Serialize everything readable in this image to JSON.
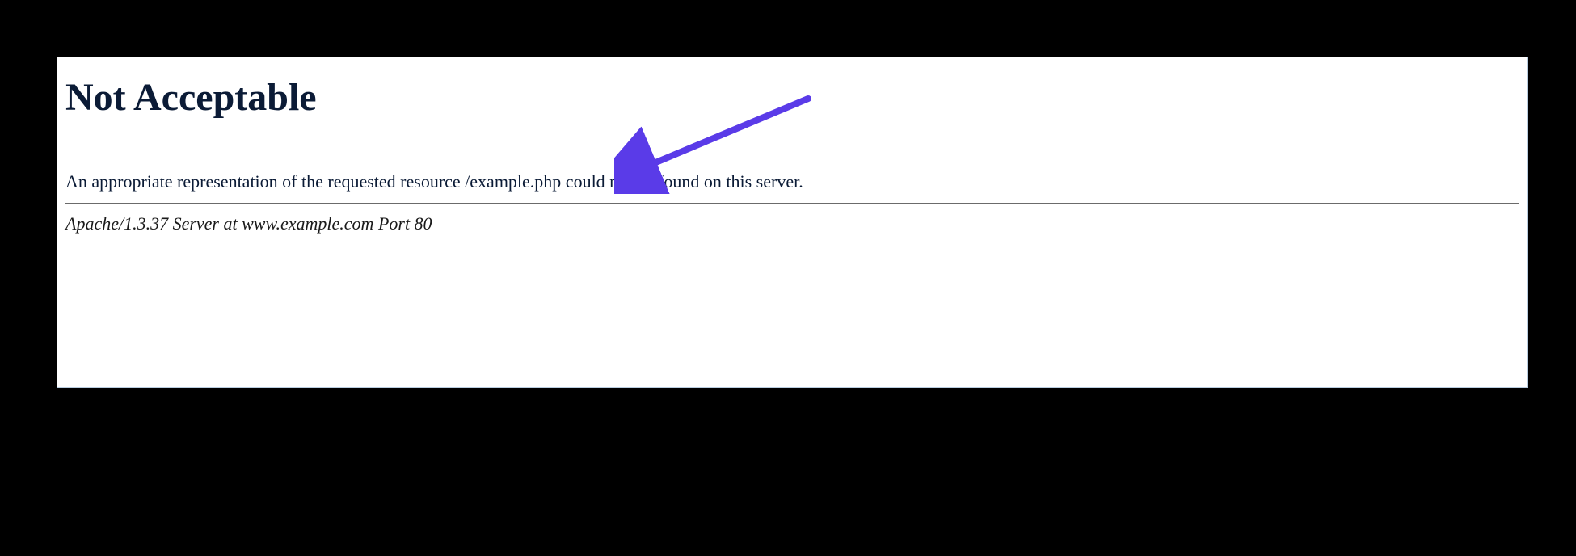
{
  "error": {
    "title": "Not Acceptable",
    "message": "An appropriate representation of the requested resource /example.php could not be found on this server.",
    "server_info": "Apache/1.3.37 Server at www.example.com Port 80"
  },
  "annotation": {
    "arrow_color": "#5a3be8"
  }
}
